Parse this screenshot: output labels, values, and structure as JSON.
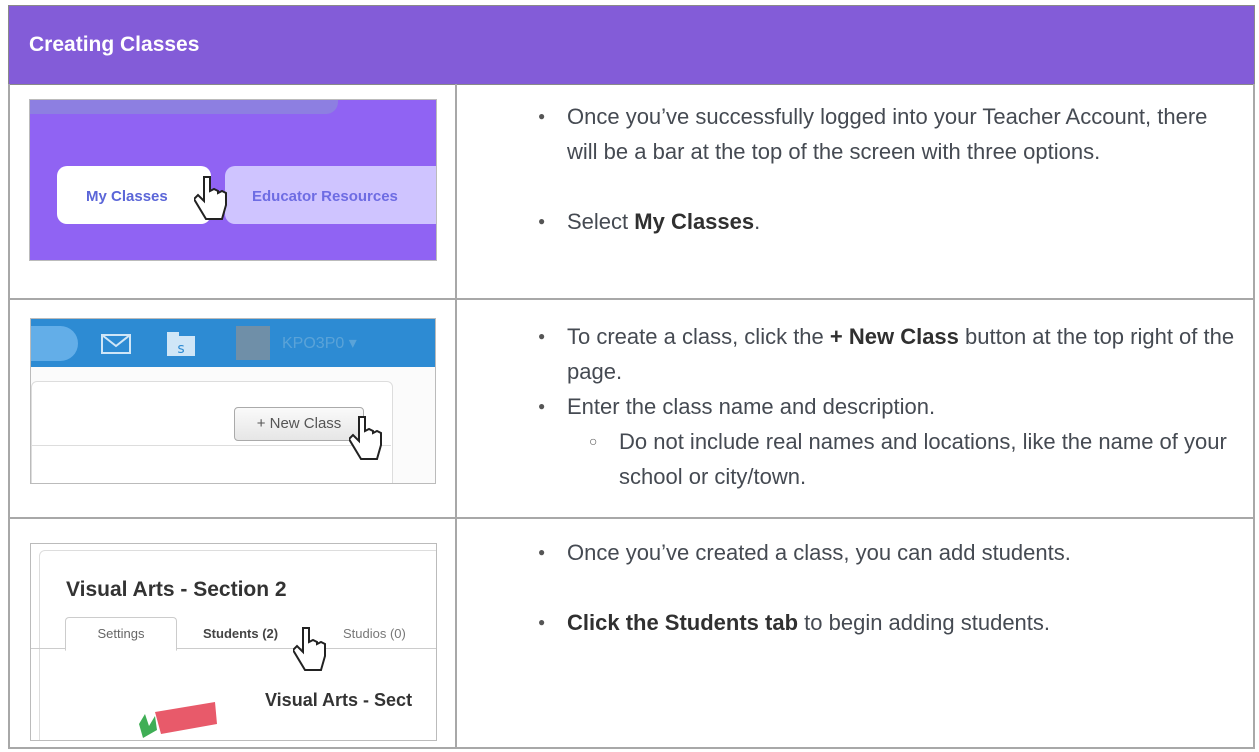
{
  "header": {
    "title": "Creating Classes"
  },
  "rows": [
    {
      "screenshot": {
        "tab_active": "My Classes",
        "tab_other": "Educator Resources"
      },
      "bullets": [
        {
          "text": "Once you’ve successfully logged into your Teacher Account, there will be a bar at the top of the screen with three options."
        },
        {
          "prefix": "Select ",
          "bold": "My Classes",
          "suffix": "."
        }
      ]
    },
    {
      "screenshot": {
        "username": "KPO3P0 ▾",
        "button_label": "+ New Class"
      },
      "bullets": [
        {
          "prefix": "To create a class, click the ",
          "bold": "+ New Class",
          "suffix": " button at the top right of the page."
        },
        {
          "text": "Enter the class name and description."
        },
        {
          "text": "Do not include real names and locations, like the name of your school or city/town.",
          "level": 2
        }
      ]
    },
    {
      "screenshot": {
        "class_title": "Visual Arts - Section 2",
        "tabs": [
          "Settings",
          "Students (2)",
          "Studios (0)"
        ],
        "subtitle": "Visual Arts - Sect"
      },
      "bullets": [
        {
          "text": "Once you’ve created a class, you can add students."
        },
        {
          "bold": "Click the Students tab",
          "suffix": " to begin adding students."
        }
      ]
    }
  ],
  "colors": {
    "header_bg": "#835cd8",
    "shot1_bg": "#9063f3",
    "shot2_bar": "#2d8bd3"
  }
}
